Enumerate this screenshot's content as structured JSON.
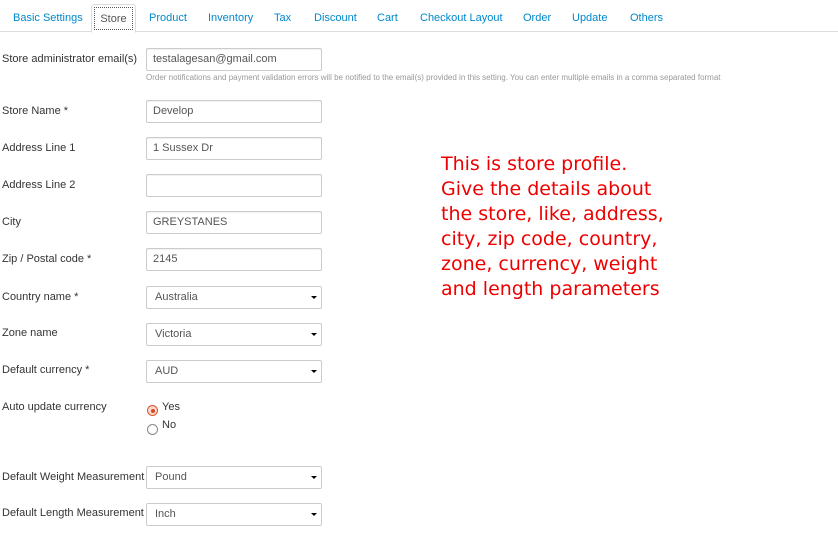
{
  "tabs": [
    {
      "label": "Basic Settings"
    },
    {
      "label": "Store"
    },
    {
      "label": "Product"
    },
    {
      "label": "Inventory"
    },
    {
      "label": "Tax"
    },
    {
      "label": "Discount"
    },
    {
      "label": "Cart"
    },
    {
      "label": "Checkout Layout"
    },
    {
      "label": "Order"
    },
    {
      "label": "Update"
    },
    {
      "label": "Others"
    }
  ],
  "form": {
    "admin_email": {
      "label": "Store administrator email(s)",
      "value": "testalagesan@gmail.com",
      "help": "Order notifications and payment validation errors will be notified to the email(s) provided in this setting. You can enter multiple emails in a comma separated format"
    },
    "store_name": {
      "label": "Store Name *",
      "value": "Develop"
    },
    "address1": {
      "label": "Address Line 1",
      "value": "1 Sussex Dr"
    },
    "address2": {
      "label": "Address Line 2",
      "value": ""
    },
    "city": {
      "label": "City",
      "value": "GREYSTANES"
    },
    "zip": {
      "label": "Zip / Postal code *",
      "value": "2145"
    },
    "country": {
      "label": "Country name *",
      "value": "Australia"
    },
    "zone": {
      "label": "Zone name",
      "value": "Victoria"
    },
    "currency": {
      "label": "Default currency *",
      "value": "AUD"
    },
    "auto_update": {
      "label": "Auto update currency",
      "options": [
        {
          "label": "Yes",
          "checked": true
        },
        {
          "label": "No",
          "checked": false
        }
      ]
    },
    "weight": {
      "label": "Default Weight Measurement",
      "value": "Pound"
    },
    "length": {
      "label": "Default Length Measurement",
      "value": "Inch"
    }
  },
  "annotation": {
    "text": "This is store profile.\nGive the details about\nthe store, like, address,\ncity, zip code, country,\nzone, currency, weight\nand length parameters",
    "color": "#ee0000"
  },
  "colors": {
    "link": "#0088cc",
    "radio_accent": "#d8582a"
  }
}
